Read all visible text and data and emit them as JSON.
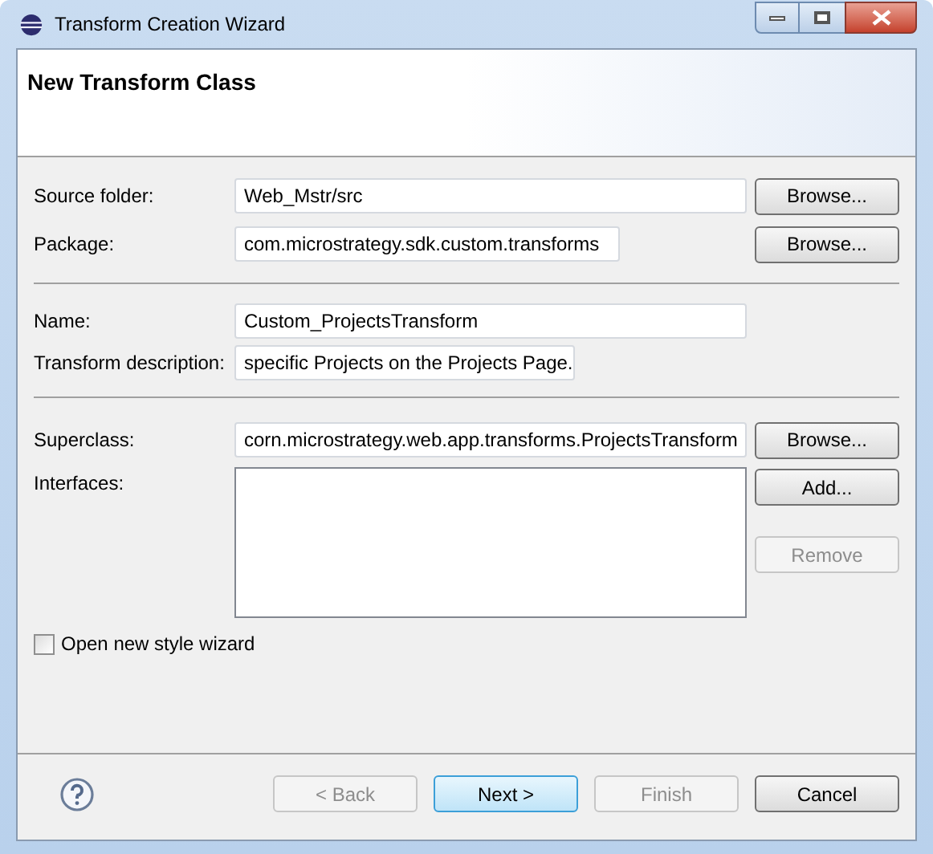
{
  "window": {
    "title": "Transform Creation Wizard"
  },
  "header": {
    "title": "New Transform Class"
  },
  "sections": [
    {
      "fields": [
        {
          "label": "Source folder:",
          "value": "Web_Mstr/src",
          "button": "Browse..."
        },
        {
          "label": "Package:",
          "value": "com.microstrategy.sdk.custom.transforms",
          "button": "Browse..."
        }
      ]
    },
    {
      "fields": [
        {
          "label": "Name:",
          "value": "Custom_ProjectsTransform"
        },
        {
          "label": "Transform description:",
          "value": "specific Projects on the Projects Page."
        }
      ]
    },
    {
      "fields": [
        {
          "label": "Superclass:",
          "value": "corn.microstrategy.web.app.transforms.ProjectsTransform",
          "button": "Browse..."
        }
      ]
    }
  ],
  "interfaces": {
    "label": "Interfaces:",
    "buttons": [
      {
        "label": "Add...",
        "disabled": false
      },
      {
        "label": "Remove",
        "disabled": true
      }
    ]
  },
  "checkbox": {
    "label": "Open new style wizard",
    "checked": false
  },
  "buttons": [
    {
      "label": "< Back",
      "disabled": true,
      "default": false
    },
    {
      "label": "Next >",
      "disabled": false,
      "default": true
    },
    {
      "label": "Finish",
      "disabled": true,
      "default": false
    },
    {
      "label": "Cancel",
      "disabled": false,
      "default": false
    }
  ]
}
